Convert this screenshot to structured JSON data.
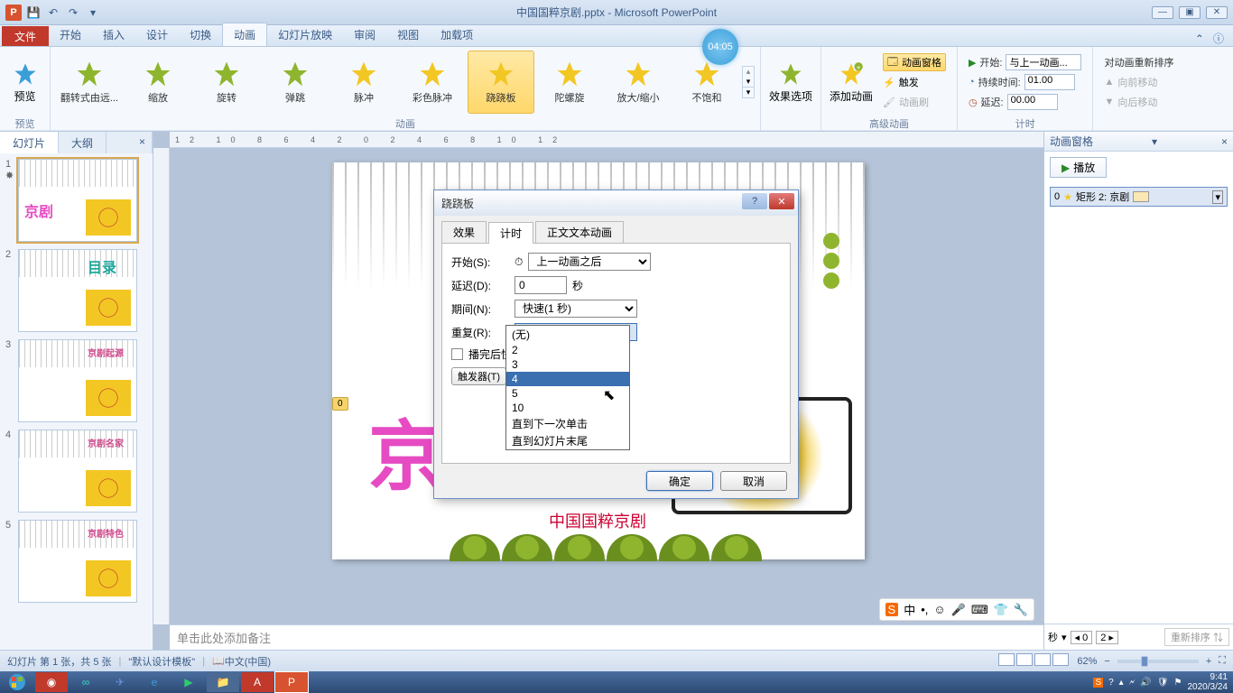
{
  "titlebar": {
    "app_logo": "P",
    "title": "中国国粹京剧.pptx - Microsoft PowerPoint"
  },
  "ribbon_tabs": {
    "file": "文件",
    "items": [
      "开始",
      "插入",
      "设计",
      "切换",
      "动画",
      "幻灯片放映",
      "审阅",
      "视图",
      "加载项"
    ],
    "active_index": 4
  },
  "ribbon": {
    "preview": {
      "label": "预览",
      "group": "预览"
    },
    "anims": [
      {
        "name": "翻转式由远..."
      },
      {
        "name": "缩放"
      },
      {
        "name": "旋转"
      },
      {
        "name": "弹跳"
      },
      {
        "name": "脉冲"
      },
      {
        "name": "彩色脉冲"
      },
      {
        "name": "跷跷板",
        "selected": true
      },
      {
        "name": "陀螺旋"
      },
      {
        "name": "放大/缩小"
      },
      {
        "name": "不饱和"
      }
    ],
    "anim_group": "动画",
    "effect_options": "效果选项",
    "add_anim": "添加动画",
    "adv_group": "高级动画",
    "adv": {
      "pane": "动画窗格",
      "trigger": "触发",
      "painter": "动画刷"
    },
    "timing": {
      "start_label": "开始:",
      "start_value": "与上一动画...",
      "duration_label": "持续时间:",
      "duration_value": "01.00",
      "delay_label": "延迟:",
      "delay_value": "00.00",
      "group": "计时"
    },
    "reorder": {
      "title": "对动画重新排序",
      "prev": "向前移动",
      "next": "向后移动"
    }
  },
  "side": {
    "tab_slides": "幻灯片",
    "tab_outline": "大纲",
    "thumbs": [
      {
        "title": "京剧",
        "color": "#e64bc3"
      },
      {
        "title": "目录",
        "color": "#1fa89c"
      },
      {
        "title": "京剧起源",
        "color": "#d04a8c"
      },
      {
        "title": "京剧名家",
        "color": "#d04a8c"
      },
      {
        "title": "京剧特色",
        "color": "#d04a8c"
      }
    ]
  },
  "slide": {
    "big": "京剧",
    "sub": "中国国粹京剧",
    "tag": "0"
  },
  "notes_placeholder": "单击此处添加备注",
  "anim_pane": {
    "title": "动画窗格",
    "play": "播放",
    "item_index": "0",
    "item_label": "矩形 2: 京剧",
    "seconds": "秒",
    "reorder": "重新排序"
  },
  "dialog": {
    "title": "跷跷板",
    "tabs": [
      "效果",
      "计时",
      "正文文本动画"
    ],
    "active_tab_index": 1,
    "start_label": "开始(S):",
    "start_value": "上一动画之后",
    "delay_label": "延迟(D):",
    "delay_value": "0",
    "delay_unit": "秒",
    "duration_label": "期间(N):",
    "duration_value": "快速(1 秒)",
    "repeat_label": "重复(R):",
    "repeat_value": "(无)",
    "rewind_label": "播完后快",
    "trigger_label": "触发器(T)",
    "dropdown": [
      "(无)",
      "2",
      "3",
      "4",
      "5",
      "10",
      "直到下一次单击",
      "直到幻灯片末尾"
    ],
    "dropdown_hl_index": 3,
    "ok": "确定",
    "cancel": "取消"
  },
  "status": {
    "slide_info": "幻灯片 第 1 张，共 5 张",
    "template": "\"默认设计模板\"",
    "lang": "中文(中国)",
    "zoom": "62%"
  },
  "timer": "04:05",
  "ime": {
    "ch": "中"
  },
  "tray": {
    "time": "9:41",
    "date": "2020/3/24"
  },
  "ruler_text": "12 10 8 6 4 2 0 2 4 6 8 10 12",
  "anim_foot_nums": {
    "a": "0",
    "b": "2"
  }
}
